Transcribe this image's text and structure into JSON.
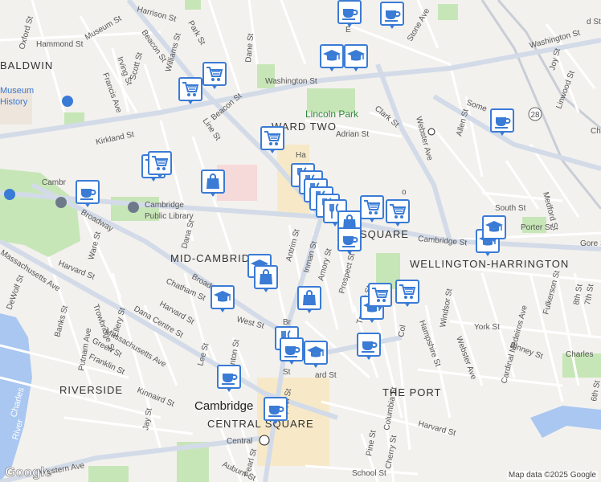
{
  "streets": [
    {
      "id": "harrison",
      "text": "Harrison St"
    },
    {
      "id": "oxford",
      "text": "Oxford St"
    },
    {
      "id": "hammond",
      "text": "Hammond St"
    },
    {
      "id": "museum",
      "text": "Museum St"
    },
    {
      "id": "park",
      "text": "Park St"
    },
    {
      "id": "beacon1",
      "text": "Beacon St"
    },
    {
      "id": "dane",
      "text": "Dane St"
    },
    {
      "id": "irving",
      "text": "Irving St"
    },
    {
      "id": "francis",
      "text": "Francis Ave"
    },
    {
      "id": "scott",
      "text": "Scott St"
    },
    {
      "id": "washington1",
      "text": "Washington St"
    },
    {
      "id": "washington2",
      "text": "Washington St"
    },
    {
      "id": "stone",
      "text": "Stone Ave"
    },
    {
      "id": "joy",
      "text": "Joy St"
    },
    {
      "id": "linwood",
      "text": "Linwood St"
    },
    {
      "id": "kirkland",
      "text": "Kirkland St"
    },
    {
      "id": "line",
      "text": "Line St"
    },
    {
      "id": "beacon2",
      "text": "Beacon St"
    },
    {
      "id": "adrian",
      "text": "Adrian St"
    },
    {
      "id": "clark",
      "text": "Clark St"
    },
    {
      "id": "webster",
      "text": "Webster Ave"
    },
    {
      "id": "allen",
      "text": "Allen St"
    },
    {
      "id": "somerville",
      "text": "Some"
    },
    {
      "id": "cambridge_w",
      "text": "Cambr"
    },
    {
      "id": "broadway1",
      "text": "Broadway"
    },
    {
      "id": "ware",
      "text": "Ware St"
    },
    {
      "id": "dana",
      "text": "Dana St"
    },
    {
      "id": "antrim",
      "text": "Antrim St"
    },
    {
      "id": "inman",
      "text": "Inman St"
    },
    {
      "id": "amory",
      "text": "Amory St"
    },
    {
      "id": "prospect",
      "text": "Prospect St"
    },
    {
      "id": "south",
      "text": "South St"
    },
    {
      "id": "porter",
      "text": "Porter St"
    },
    {
      "id": "medford",
      "text": "Medford St"
    },
    {
      "id": "gore",
      "text": "Gore S"
    },
    {
      "id": "cambridge_e",
      "text": "Cambridge St"
    },
    {
      "id": "harvard1",
      "text": "Harvard St"
    },
    {
      "id": "trowbridge",
      "text": "Trowbridge St"
    },
    {
      "id": "chatham",
      "text": "Chatham St"
    },
    {
      "id": "harvard2",
      "text": "Harvard St"
    },
    {
      "id": "broadway2",
      "text": "Broadway"
    },
    {
      "id": "west",
      "text": "West St"
    },
    {
      "id": "massave1",
      "text": "Massachusetts Ave"
    },
    {
      "id": "massave2",
      "text": "Massachusetts Ave"
    },
    {
      "id": "dewolf",
      "text": "DeWolf St"
    },
    {
      "id": "banks",
      "text": "Banks St"
    },
    {
      "id": "putnam",
      "text": "Putnam Ave"
    },
    {
      "id": "ellery",
      "text": "Ellery St"
    },
    {
      "id": "danacentre",
      "text": "Dana Centre St"
    },
    {
      "id": "green",
      "text": "Green St"
    },
    {
      "id": "franklin",
      "text": "Franklin St"
    },
    {
      "id": "kinnaird",
      "text": "Kinnaird St"
    },
    {
      "id": "lee",
      "text": "Lee St"
    },
    {
      "id": "clinton",
      "text": "Clinton St"
    },
    {
      "id": "tremont",
      "text": "Tremont St"
    },
    {
      "id": "columbia",
      "text": "Columbia St"
    },
    {
      "id": "hampshire",
      "text": "Hampshire St"
    },
    {
      "id": "windsor",
      "text": "Windsor St"
    },
    {
      "id": "webster2",
      "text": "Webster Ave"
    },
    {
      "id": "york",
      "text": "York St"
    },
    {
      "id": "cardinal",
      "text": "Cardinal Medeiros Ave"
    },
    {
      "id": "fulkerson",
      "text": "Fulkerson St"
    },
    {
      "id": "binney",
      "text": "Binney St"
    },
    {
      "id": "charles",
      "text": "Charles"
    },
    {
      "id": "harvard3",
      "text": "Harvard St"
    },
    {
      "id": "pine",
      "text": "Pine St"
    },
    {
      "id": "cherry",
      "text": "Cherry St"
    },
    {
      "id": "school",
      "text": "School St"
    },
    {
      "id": "western",
      "text": "Western Ave"
    },
    {
      "id": "auburn",
      "text": "Auburn St"
    },
    {
      "id": "pearl",
      "text": "Pearl St"
    },
    {
      "id": "jay",
      "text": "Jay St"
    },
    {
      "id": "prospect2",
      "text": "spect St"
    },
    {
      "id": "brow",
      "text": "Br"
    },
    {
      "id": "ardst",
      "text": "ard St"
    },
    {
      "id": "col2",
      "text": "Col"
    },
    {
      "id": "st8",
      "text": "8th St"
    },
    {
      "id": "st7",
      "text": "7th St"
    },
    {
      "id": "st6",
      "text": "6th St"
    },
    {
      "id": "che",
      "text": "Che"
    },
    {
      "id": "dst",
      "text": "d St"
    },
    {
      "id": "est",
      "text": "E"
    },
    {
      "id": "ost",
      "text": "o"
    },
    {
      "id": "rst",
      "text": "H"
    },
    {
      "id": "harvard_tiny",
      "text": "Ha"
    },
    {
      "id": "stt",
      "text": "St"
    },
    {
      "id": "williams",
      "text": "Williams St"
    }
  ],
  "areas": [
    {
      "id": "baldwin",
      "text": "BALDWIN"
    },
    {
      "id": "wardtwo",
      "text": "WARD TWO"
    },
    {
      "id": "midcambridge",
      "text": "MID-CAMBRIDGE"
    },
    {
      "id": "wellington",
      "text": "WELLINGTON-HARRINGTON"
    },
    {
      "id": "riverside",
      "text": "RIVERSIDE"
    },
    {
      "id": "theport",
      "text": "THE PORT"
    },
    {
      "id": "centralsquare",
      "text": "CENTRAL SQUARE"
    },
    {
      "id": "square",
      "text": "SQUARE"
    }
  ],
  "places": [
    {
      "id": "museum_history1",
      "text": "Museum"
    },
    {
      "id": "museum_history2",
      "text": "History"
    },
    {
      "id": "lincoln_park",
      "text": "Lincoln Park"
    },
    {
      "id": "library1",
      "text": "Cambridge"
    },
    {
      "id": "library2",
      "text": "Public Library"
    },
    {
      "id": "cambridge_city",
      "text": "Cambridge"
    },
    {
      "id": "central",
      "text": "Central"
    },
    {
      "id": "charles_river1",
      "text": "Charles"
    },
    {
      "id": "charles_river2",
      "text": "River"
    },
    {
      "id": "route28",
      "text": "28"
    }
  ],
  "markers": [
    {
      "type": "coffee"
    },
    {
      "type": "coffee"
    },
    {
      "type": "school"
    },
    {
      "type": "school"
    },
    {
      "type": "cart"
    },
    {
      "type": "cart"
    },
    {
      "type": "coffee"
    },
    {
      "type": "cart"
    },
    {
      "type": "cart"
    },
    {
      "type": "cart"
    },
    {
      "type": "coffee"
    },
    {
      "type": "bag"
    },
    {
      "type": "restaurant"
    },
    {
      "type": "restaurant"
    },
    {
      "type": "restaurant"
    },
    {
      "type": "restaurant"
    },
    {
      "type": "restaurant"
    },
    {
      "type": "restaurant"
    },
    {
      "type": "bag"
    },
    {
      "type": "cart"
    },
    {
      "type": "cart"
    },
    {
      "type": "coffee"
    },
    {
      "type": "school"
    },
    {
      "type": "school"
    },
    {
      "type": "school"
    },
    {
      "type": "bag"
    },
    {
      "type": "school"
    },
    {
      "type": "bag"
    },
    {
      "type": "school"
    },
    {
      "type": "cart"
    },
    {
      "type": "cart"
    },
    {
      "type": "coffee"
    },
    {
      "type": "restaurant"
    },
    {
      "type": "coffee"
    },
    {
      "type": "school"
    },
    {
      "type": "coffee"
    },
    {
      "type": "coffee"
    }
  ],
  "branding": {
    "logo": "Google",
    "credit": "Map data ©2025 Google"
  },
  "colors": {
    "road": "#ffffff",
    "major_road": "#c9d4e3",
    "park": "#c7e6b7",
    "water": "#a9c7f0",
    "marker": "#3a7bd5",
    "background": "#f3f1ee"
  }
}
